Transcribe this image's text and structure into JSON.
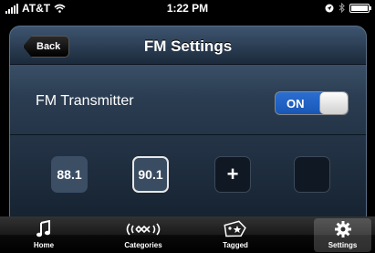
{
  "status_bar": {
    "carrier": "AT&T",
    "time": "1:22 PM"
  },
  "nav": {
    "back_label": "Back",
    "title": "FM Settings"
  },
  "setting": {
    "label": "FM Transmitter",
    "toggle_state": "ON"
  },
  "presets": [
    {
      "label": "88.1"
    },
    {
      "label": "90.1"
    },
    {
      "label": "+"
    },
    {
      "label": ""
    }
  ],
  "tabs": [
    {
      "label": "Home",
      "icon": "music-note-icon"
    },
    {
      "label": "Categories",
      "icon": "broadcast-icon"
    },
    {
      "label": "Tagged",
      "icon": "tag-icon"
    },
    {
      "label": "Settings",
      "icon": "gear-icon"
    }
  ],
  "colors": {
    "toggle_on": "#2b6fd2",
    "panel_top": "#4c6682",
    "panel_bottom": "#15212f"
  }
}
